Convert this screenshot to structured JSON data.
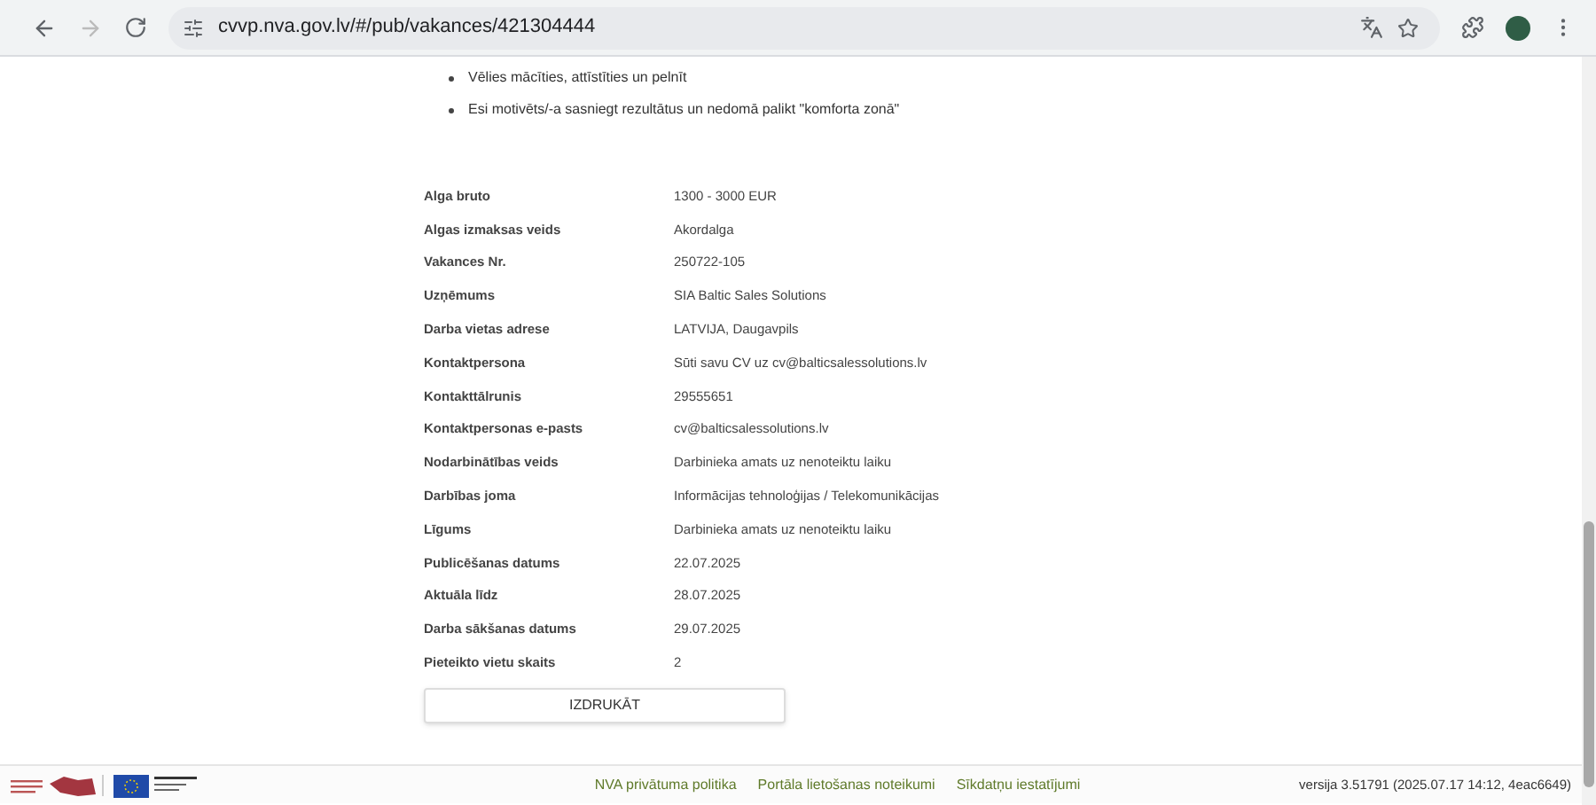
{
  "browser": {
    "url": "cvvp.nva.gov.lv/#/pub/vakances/421304444"
  },
  "bullets": [
    "Vēlies mācīties, attīstīties un pelnīt",
    "Esi motivēts/-a sasniegt rezultātus un nedomā palikt \"komforta zonā\""
  ],
  "details": [
    {
      "label": "Alga bruto",
      "value": "1300 - 3000 EUR"
    },
    {
      "label": "Algas izmaksas veids",
      "value": "Akordalga"
    },
    {
      "label": "Vakances Nr.",
      "value": "250722-105"
    },
    {
      "label": "Uzņēmums",
      "value": "SIA Baltic Sales Solutions"
    },
    {
      "label": "Darba vietas adrese",
      "value": "LATVIJA, Daugavpils"
    },
    {
      "label": "Kontaktpersona",
      "value": "Sūti savu CV uz cv@balticsalessolutions.lv"
    },
    {
      "label": "Kontakttālrunis",
      "value": "29555651"
    },
    {
      "label": "Kontaktpersonas e-pasts",
      "value": "cv@balticsalessolutions.lv"
    },
    {
      "label": "Nodarbinātības veids",
      "value": "Darbinieka amats uz nenoteiktu laiku"
    },
    {
      "label": "Darbības joma",
      "value": "Informācijas tehnoloģijas / Telekomunikācijas"
    },
    {
      "label": "Līgums",
      "value": "Darbinieka amats uz nenoteiktu laiku"
    },
    {
      "label": "Publicēšanas datums",
      "value": "22.07.2025"
    },
    {
      "label": "Aktuāla līdz",
      "value": "28.07.2025"
    },
    {
      "label": "Darba sākšanas datums",
      "value": "29.07.2025"
    },
    {
      "label": "Pieteikto vietu skaits",
      "value": "2"
    }
  ],
  "print_button": "IZDRUKĀT",
  "footer": {
    "links": [
      "NVA privātuma politika",
      "Portāla lietošanas noteikumi",
      "Sīkdatņu iestatījumi"
    ],
    "version": "versija 3.51791 (2025.07.17 14:12, 4eac6649)"
  }
}
